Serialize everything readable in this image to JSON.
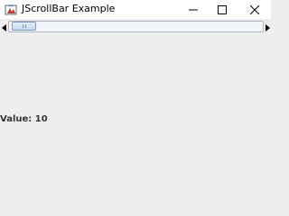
{
  "window": {
    "title": "JScrollBar Example",
    "icon": "java-app-icon",
    "controls": {
      "minimize_icon": "minimize-icon",
      "maximize_icon": "maximize-icon",
      "close_icon": "close-icon"
    }
  },
  "scrollbar": {
    "orientation": "horizontal",
    "value": 10,
    "left_arrow_icon": "chevron-left-icon",
    "right_arrow_icon": "chevron-right-icon"
  },
  "value_label": {
    "text": "Value: 10"
  },
  "colors": {
    "background": "#eeeeee",
    "titlebar": "#ffffff",
    "thumb_border": "#7b9ac2",
    "track_border": "#aab6c6"
  }
}
